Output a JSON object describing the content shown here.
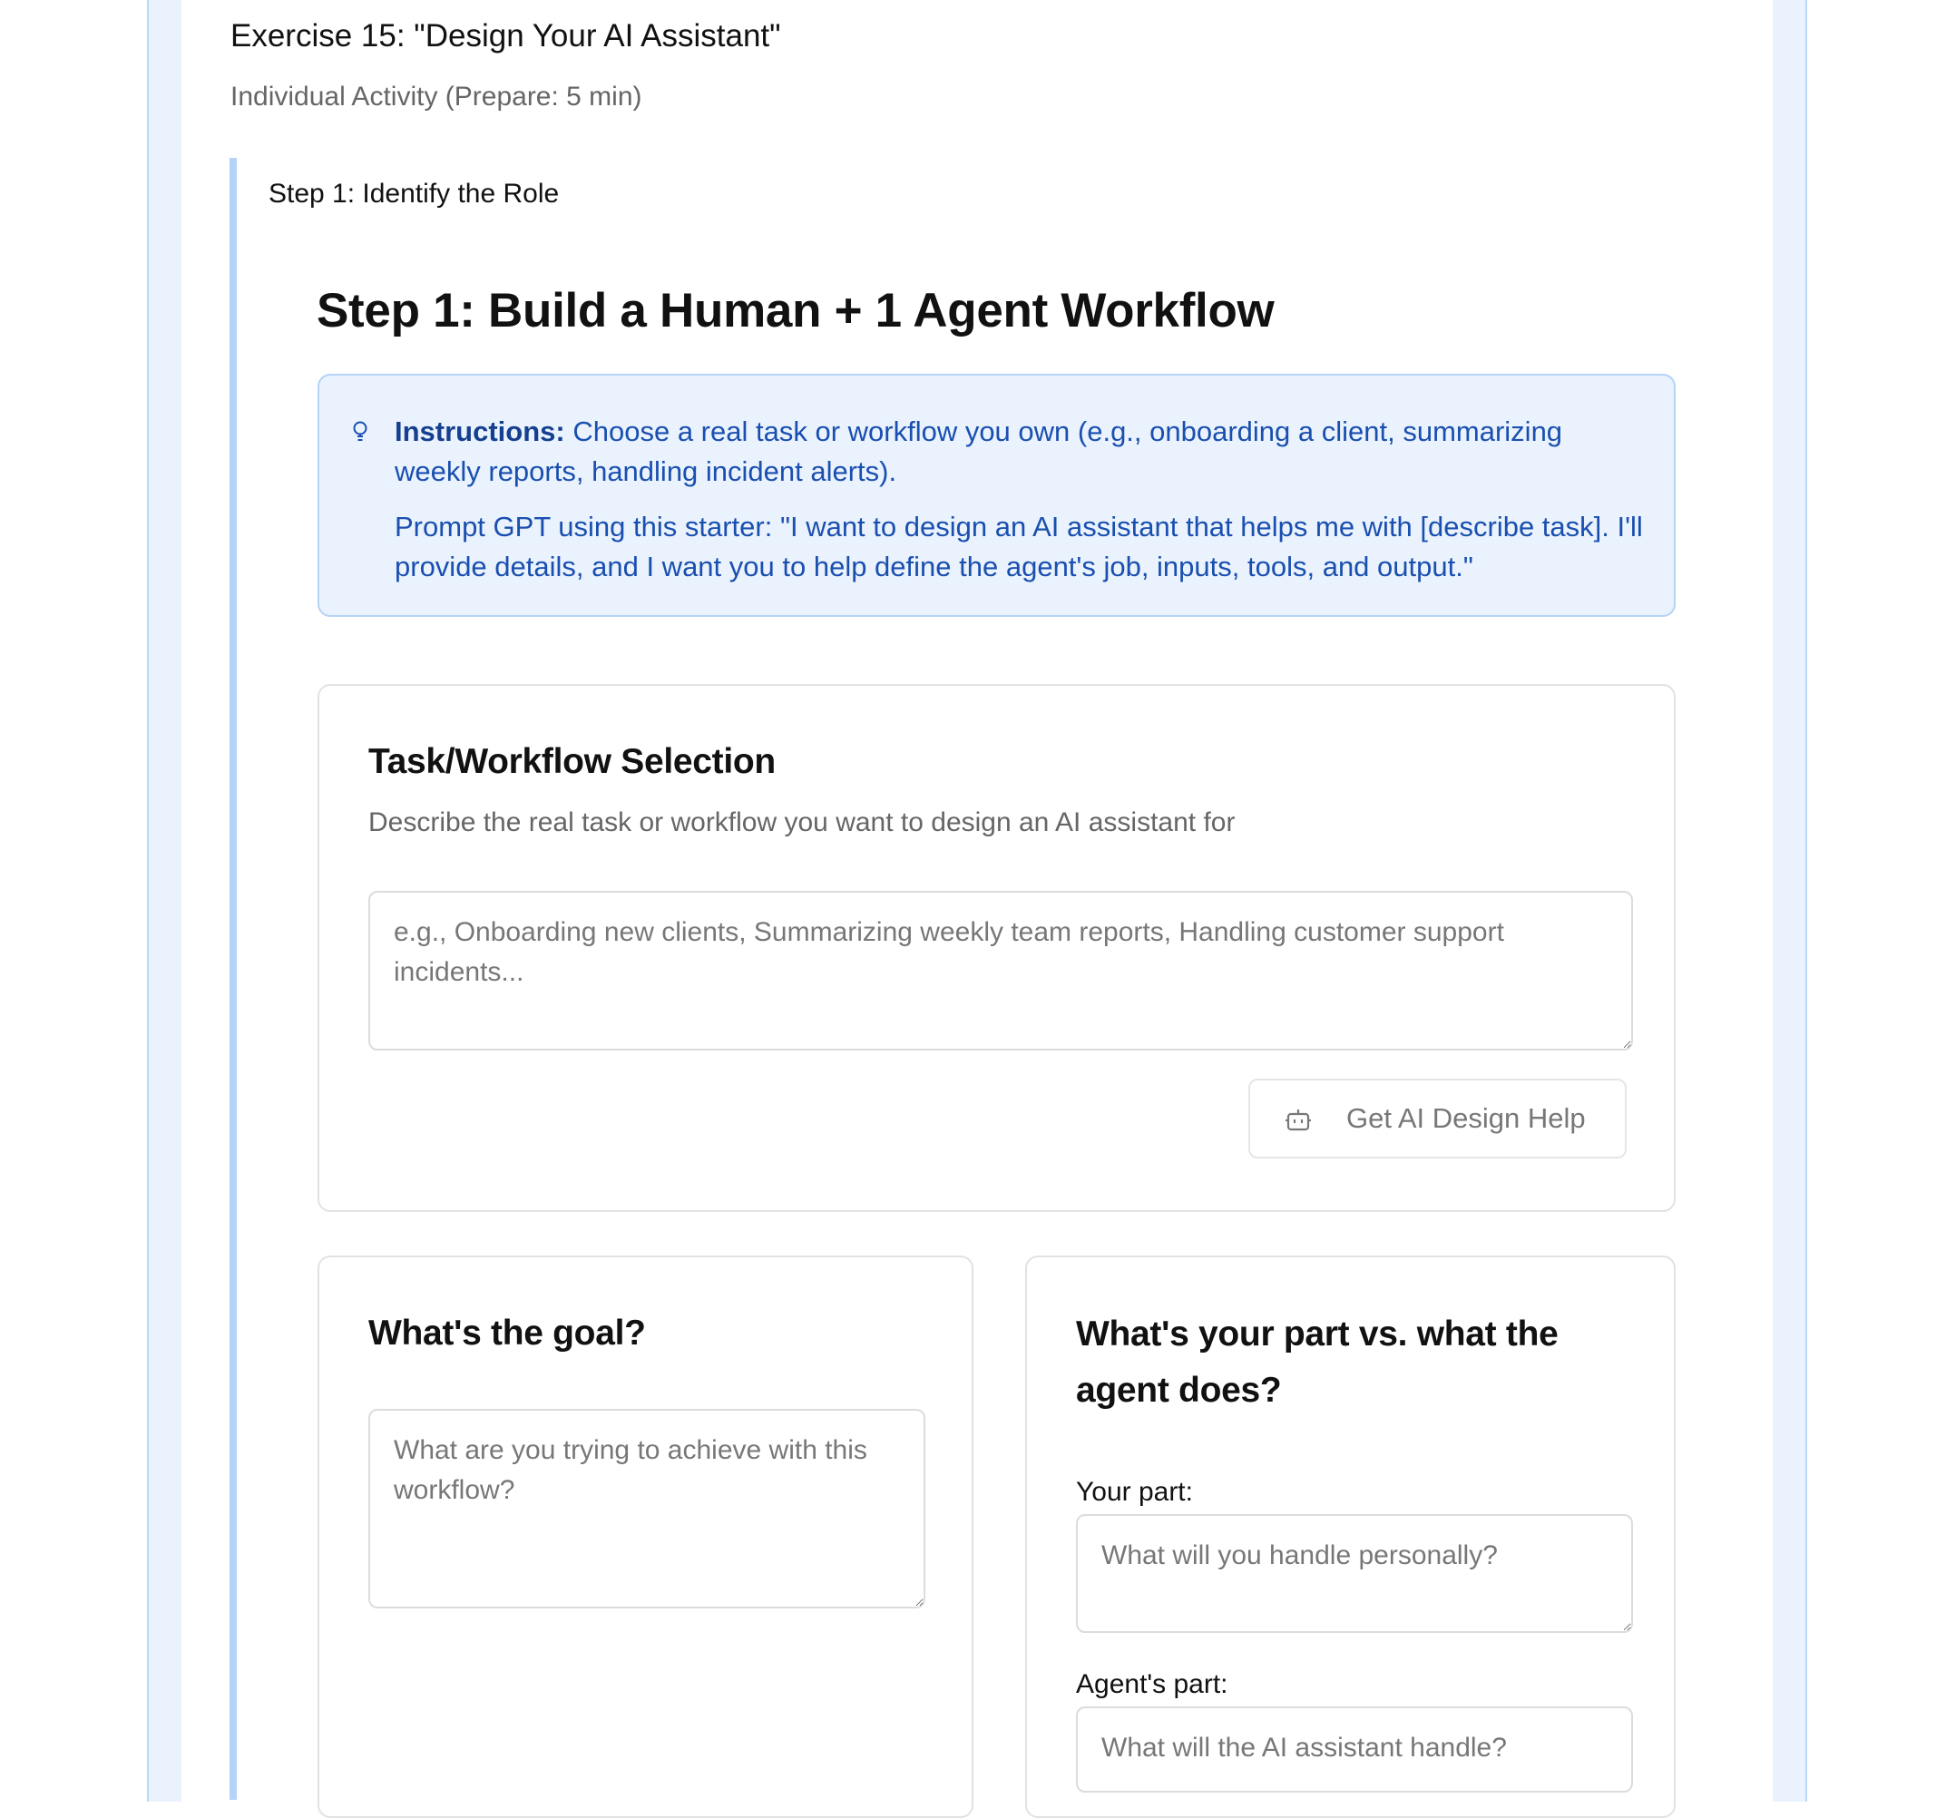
{
  "exercise": {
    "title": "Exercise 15: \"Design Your AI Assistant\"",
    "subtitle": "Individual Activity (Prepare: 5 min)"
  },
  "step": {
    "label": "Step 1: Identify the Role",
    "heading": "Step 1: Build a Human + 1 Agent Workflow"
  },
  "instructions": {
    "icon": "lightbulb-icon",
    "lead": "Instructions:",
    "text": "Choose a real task or workflow you own (e.g., onboarding a client, summarizing weekly reports, handling incident alerts).",
    "prompt": "Prompt GPT using this starter: \"I want to design an AI assistant that helps me with [describe task]. I'll provide details, and I want you to help define the agent's job, inputs, tools, and output.\""
  },
  "task_selection": {
    "title": "Task/Workflow Selection",
    "description": "Describe the real task or workflow you want to design an AI assistant for",
    "placeholder": "e.g., Onboarding new clients, Summarizing weekly team reports, Handling customer support incidents...",
    "value": "",
    "button_icon": "robot-icon",
    "button_label": "Get AI Design Help"
  },
  "goal": {
    "title": "What's the goal?",
    "placeholder": "What are you trying to achieve with this workflow?",
    "value": ""
  },
  "roles": {
    "title": "What's your part vs. what the agent does?",
    "your_part_label": "Your part:",
    "your_part_placeholder": "What will you handle personally?",
    "agent_part_label": "Agent's part:",
    "agent_part_placeholder": "What will the AI assistant handle?"
  },
  "colors": {
    "accent_blue": "#1a4fb0",
    "info_bg": "#eaf3fd",
    "info_border": "#b5d3f7"
  }
}
